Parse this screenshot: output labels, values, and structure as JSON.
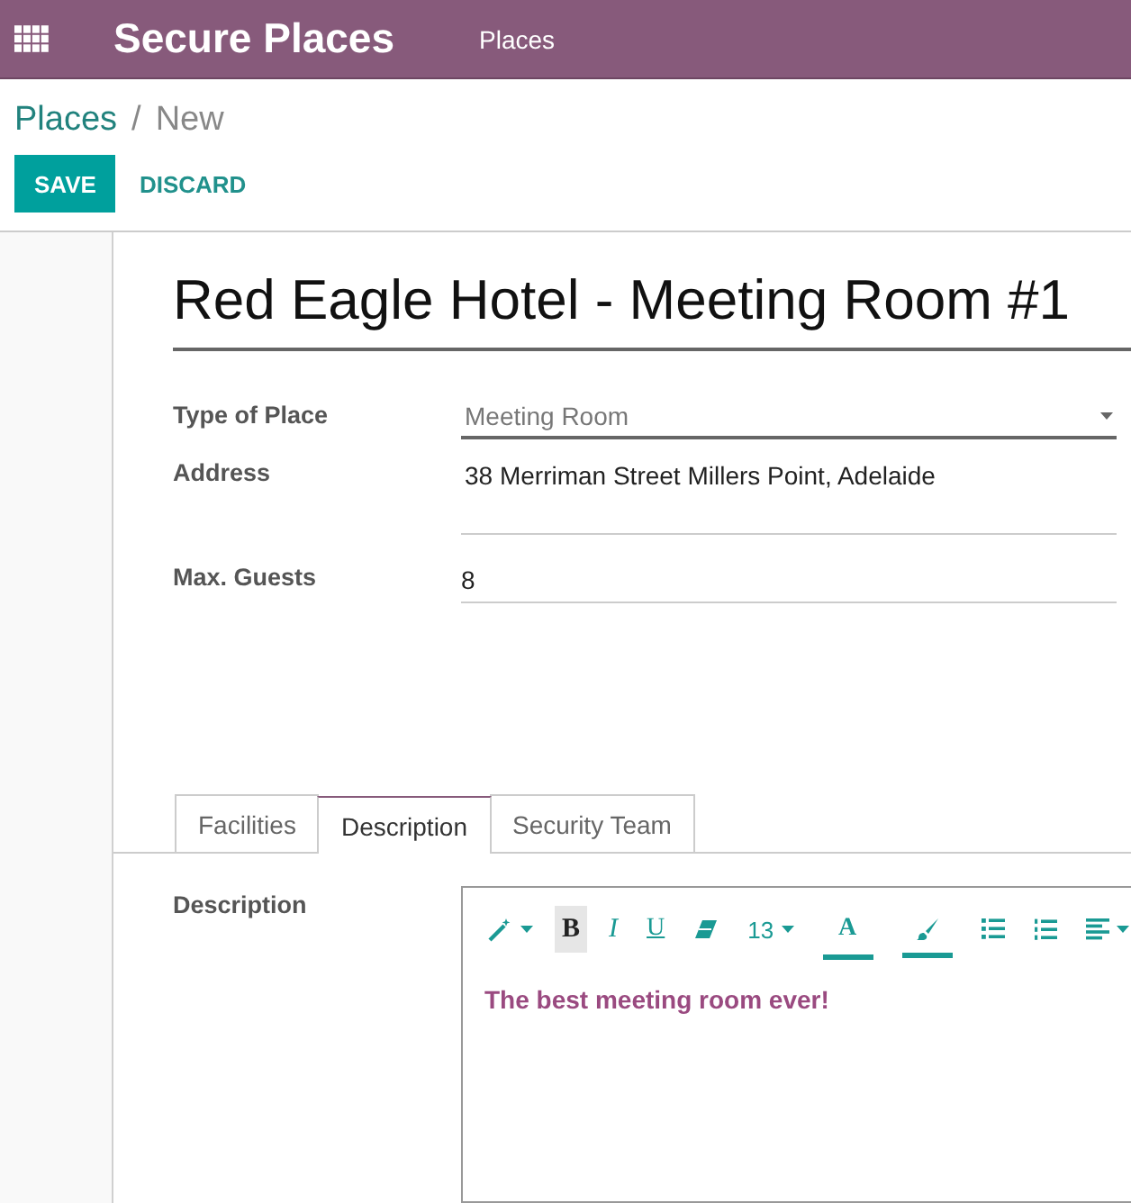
{
  "navbar": {
    "app_title": "Secure Places",
    "menu": [
      {
        "label": "Places"
      }
    ]
  },
  "breadcrumb": {
    "separator": "/",
    "items": [
      {
        "label": "Places",
        "kind": "link"
      },
      {
        "label": "New",
        "kind": "current"
      }
    ]
  },
  "buttons": [
    {
      "label": "SAVE",
      "kind": "primary"
    },
    {
      "label": "DISCARD",
      "kind": "link"
    }
  ],
  "form": {
    "title": "Red Eagle Hotel - Meeting Room #1",
    "fields": [
      {
        "label": "Type of Place",
        "kind": "select",
        "value": "Meeting Room"
      },
      {
        "label": "Address",
        "kind": "textarea",
        "value": "38 Merriman Street Millers Point, Adelaide"
      },
      {
        "label": "Max. Guests",
        "kind": "input",
        "value": "8"
      }
    ]
  },
  "tabs": [
    {
      "label": "Facilities",
      "selected": false
    },
    {
      "label": "Description",
      "selected": true
    },
    {
      "label": "Security Team",
      "selected": false
    }
  ],
  "description": {
    "label": "Description",
    "content": "The best meeting room ever!",
    "toolbar": [
      {
        "kind": "wand",
        "dropdown": true,
        "active": false
      },
      {
        "kind": "bold",
        "text": "B",
        "dropdown": false,
        "active": true
      },
      {
        "kind": "italic",
        "text": "I",
        "dropdown": false,
        "active": false
      },
      {
        "kind": "underline",
        "text": "U",
        "dropdown": false,
        "active": false
      },
      {
        "kind": "eraser",
        "dropdown": false,
        "active": false
      },
      {
        "kind": "size",
        "text": "13",
        "dropdown": true,
        "active": false
      },
      {
        "kind": "color",
        "text": "A",
        "dropdown": false,
        "active": false
      },
      {
        "kind": "brush",
        "dropdown": false,
        "active": false
      },
      {
        "kind": "bullets",
        "dropdown": false,
        "active": false
      },
      {
        "kind": "numbers",
        "dropdown": false,
        "active": false
      },
      {
        "kind": "align",
        "dropdown": true,
        "active": false
      }
    ]
  }
}
